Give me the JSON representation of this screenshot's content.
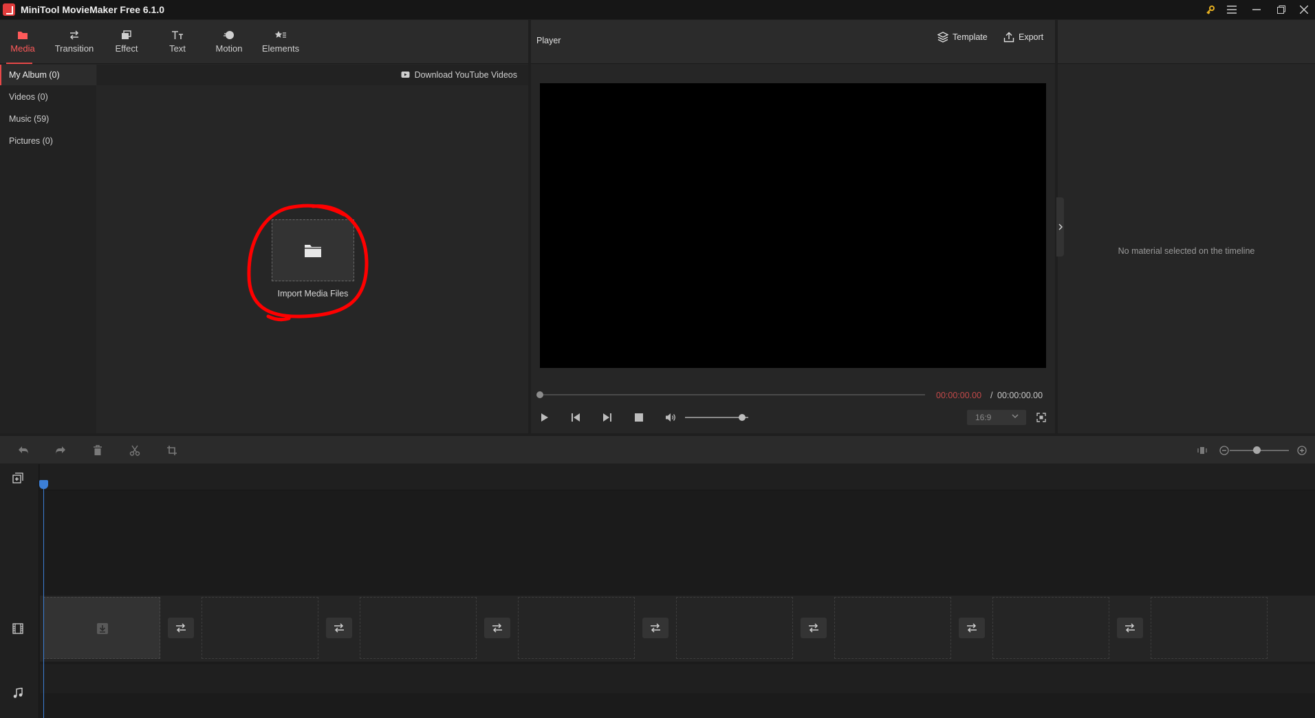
{
  "window": {
    "title": "MiniTool MovieMaker Free 6.1.0"
  },
  "toolbar": {
    "items": [
      {
        "label": "Media",
        "icon": "media-folder-icon"
      },
      {
        "label": "Transition",
        "icon": "transition-arrows-icon"
      },
      {
        "label": "Effect",
        "icon": "effect-layers-icon"
      },
      {
        "label": "Text",
        "icon": "text-tt-icon"
      },
      {
        "label": "Motion",
        "icon": "motion-ball-icon"
      },
      {
        "label": "Elements",
        "icon": "elements-star-icon"
      }
    ]
  },
  "album": {
    "items": [
      {
        "label": "My Album (0)"
      },
      {
        "label": "Videos (0)"
      },
      {
        "label": "Music (59)"
      },
      {
        "label": "Pictures (0)"
      }
    ]
  },
  "media": {
    "download_label": "Download YouTube Videos",
    "import_label": "Import Media Files"
  },
  "player": {
    "title": "Player",
    "template_label": "Template",
    "export_label": "Export",
    "time_current": "00:00:00.00",
    "time_separator": "/",
    "time_total": "00:00:00.00",
    "aspect_ratio": "16:9",
    "progress": 0,
    "volume": 0.9
  },
  "properties": {
    "empty_message": "No material selected on the timeline"
  },
  "timeline": {
    "zoom_level": 0.45
  },
  "colors": {
    "accent": "#e84848",
    "playhead": "#3c7fd6",
    "time_current": "#c54a4a",
    "annotation": "#ff0000"
  }
}
